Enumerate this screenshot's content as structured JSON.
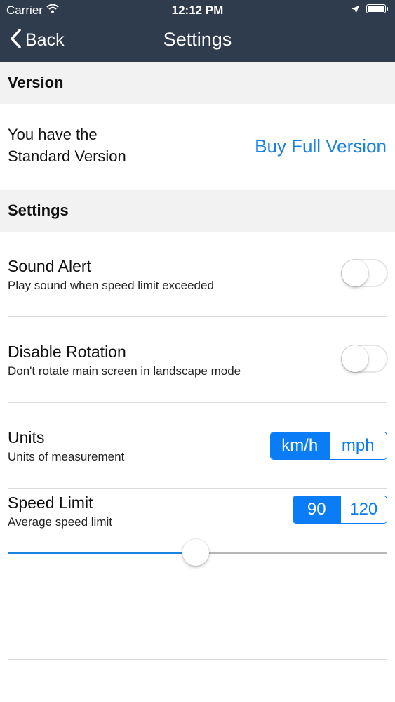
{
  "status_bar": {
    "carrier": "Carrier",
    "time": "12:12 PM"
  },
  "nav": {
    "back_label": "Back",
    "title": "Settings"
  },
  "version_section": {
    "header": "Version",
    "line1": "You have the",
    "line2": "Standard Version",
    "buy_label": "Buy Full Version"
  },
  "settings_section": {
    "header": "Settings"
  },
  "sound_alert": {
    "title": "Sound Alert",
    "subtitle": "Play sound when speed limit exceeded",
    "on": false
  },
  "disable_rotation": {
    "title": "Disable Rotation",
    "subtitle": "Don't rotate main screen in landscape mode",
    "on": false
  },
  "units": {
    "title": "Units",
    "subtitle": "Units of measurement",
    "options": [
      "km/h",
      "mph"
    ],
    "selected": "km/h"
  },
  "speed_limit": {
    "title": "Speed Limit",
    "subtitle": "Average speed limit",
    "options": [
      "90",
      "120"
    ],
    "selected": "90",
    "slider_fraction": 0.496
  },
  "colors": {
    "nav_bg": "#2e3c4e",
    "accent": "#0a7cf5",
    "link": "#1a82e0",
    "section_bg": "#f2f2f2"
  }
}
